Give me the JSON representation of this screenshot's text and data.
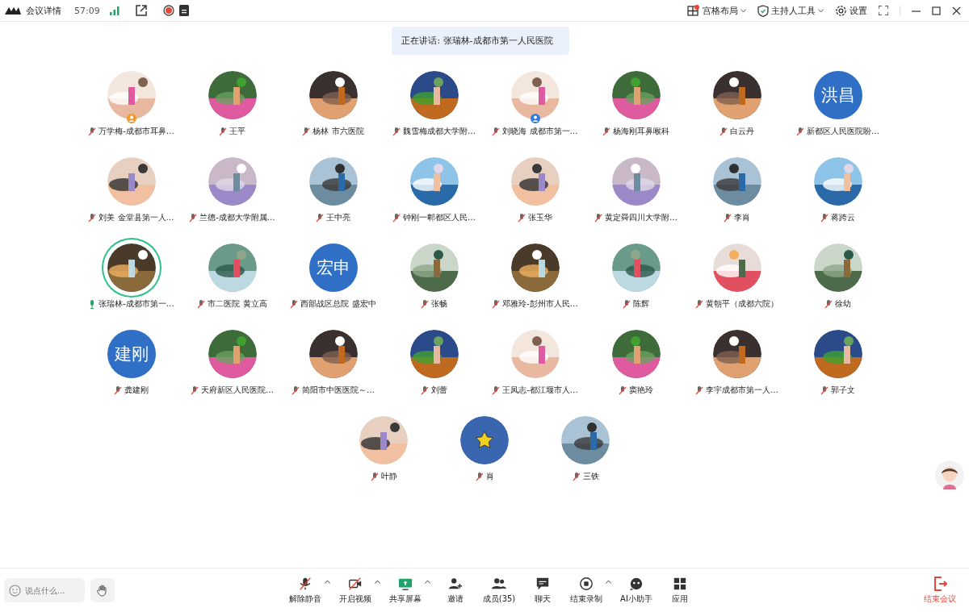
{
  "topbar": {
    "title": "会议详情",
    "timer": "57:09",
    "layout_menu": "宫格布局",
    "layout_badge": true,
    "host_menu": "主持人工具",
    "settings": "设置"
  },
  "speaking": {
    "label": "正在讲话: 张瑞林-成都市第一人民医院"
  },
  "rows": [
    [
      {
        "name": "万学梅-成都市耳鼻…",
        "muted": true,
        "speaking": false,
        "color": "#f29a2e"
      },
      {
        "name": "王平",
        "muted": true,
        "speaking": false
      },
      {
        "name": "杨林 市六医院",
        "muted": true,
        "speaking": false
      },
      {
        "name": "魏雪梅成都大学附…",
        "muted": true,
        "speaking": false
      },
      {
        "name": "刘晓海 成都市第一…",
        "muted": true,
        "speaking": false,
        "color": "#2f7be6"
      },
      {
        "name": "杨海刚耳鼻喉科",
        "muted": true,
        "speaking": false
      },
      {
        "name": "白云丹",
        "muted": true,
        "speaking": false
      },
      {
        "name": "新都区人民医院盼…",
        "muted": true,
        "speaking": false,
        "avatar": {
          "kind": "text",
          "text": "洪昌"
        }
      }
    ],
    [
      {
        "name": "刘美 金堂县第一人…",
        "muted": true,
        "speaking": false
      },
      {
        "name": "兰德-成都大学附属…",
        "muted": true,
        "speaking": false
      },
      {
        "name": "王中亮",
        "muted": true,
        "speaking": false
      },
      {
        "name": "钟刚一郫都区人民…",
        "muted": true,
        "speaking": false
      },
      {
        "name": "张玉华",
        "muted": true,
        "speaking": false
      },
      {
        "name": "黄定舜四川大学附…",
        "muted": true,
        "speaking": false
      },
      {
        "name": "李肖",
        "muted": true,
        "speaking": false
      },
      {
        "name": "蒋跨云",
        "muted": true,
        "speaking": false
      }
    ],
    [
      {
        "name": "张瑞林-成都市第一…",
        "muted": false,
        "speaking": true
      },
      {
        "name": "市二医院 黄立高",
        "muted": true,
        "speaking": false
      },
      {
        "name": "西部战区总院 盛宏中",
        "muted": true,
        "speaking": false,
        "avatar": {
          "kind": "text",
          "text": "宏申"
        }
      },
      {
        "name": "张畅",
        "muted": true,
        "speaking": false
      },
      {
        "name": "邓雅玲-彭州市人民…",
        "muted": true,
        "speaking": false
      },
      {
        "name": "陈辉",
        "muted": true,
        "speaking": false
      },
      {
        "name": "黄朝平（成都六院）",
        "muted": true,
        "speaking": false
      },
      {
        "name": "徐幼",
        "muted": true,
        "speaking": false
      }
    ],
    [
      {
        "name": "龚建刚",
        "muted": true,
        "speaking": false,
        "avatar": {
          "kind": "text",
          "text": "建刚"
        }
      },
      {
        "name": "天府新区人民医院…",
        "muted": true,
        "speaking": false
      },
      {
        "name": "简阳市中医医院～…",
        "muted": true,
        "speaking": false
      },
      {
        "name": "刘蕾",
        "muted": true,
        "speaking": false
      },
      {
        "name": "王凤志-都江堰市人…",
        "muted": true,
        "speaking": false
      },
      {
        "name": "窦艳玲",
        "muted": true,
        "speaking": false
      },
      {
        "name": "李宇成都市第一人…",
        "muted": true,
        "speaking": false
      },
      {
        "name": "郭子文",
        "muted": true,
        "speaking": false
      }
    ],
    [
      {
        "name": "叶静",
        "muted": true,
        "speaking": false
      },
      {
        "name": "肖",
        "muted": true,
        "speaking": false,
        "avatar": {
          "kind": "star"
        }
      },
      {
        "name": "三铁",
        "muted": true,
        "speaking": false
      }
    ]
  ],
  "chat_input": {
    "placeholder": "说点什么..."
  },
  "toolbar": [
    {
      "label": "解除静音",
      "kind": "mic",
      "caret": true
    },
    {
      "label": "开启视频",
      "kind": "video",
      "caret": true
    },
    {
      "label": "共享屏幕",
      "kind": "share",
      "caret": true
    },
    {
      "label": "邀请",
      "kind": "invite",
      "caret": false
    },
    {
      "label": "成员(35)",
      "kind": "members",
      "caret": false
    },
    {
      "label": "聊天",
      "kind": "chat",
      "caret": false
    },
    {
      "label": "结束录制",
      "kind": "record",
      "caret": true
    },
    {
      "label": "AI小助手",
      "kind": "assistant",
      "caret": false
    },
    {
      "label": "应用",
      "kind": "apps",
      "caret": false
    }
  ],
  "end_button": "结束会议"
}
